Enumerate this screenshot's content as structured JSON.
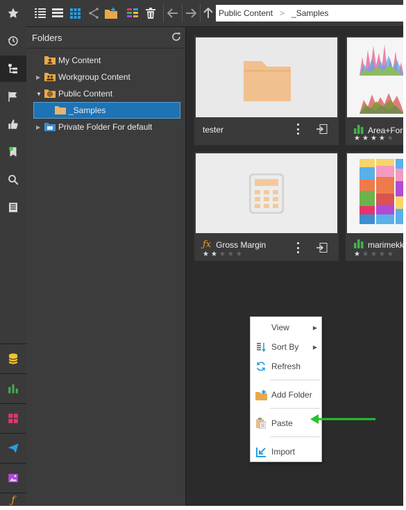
{
  "toolbar": {
    "breadcrumb": [
      "Public Content",
      "_Samples"
    ]
  },
  "folders_panel": {
    "title": "Folders",
    "items": [
      {
        "label": "My Content"
      },
      {
        "label": "Workgroup Content"
      },
      {
        "label": "Public Content"
      },
      {
        "label": "_Samples"
      },
      {
        "label": "Private Folder For default"
      }
    ]
  },
  "tiles": [
    {
      "title": "tester",
      "icon": "folder-icon",
      "stars_filled": 0
    },
    {
      "title": "Area+For",
      "icon": "chart-icon",
      "stars_filled": 4,
      "star_color": "#e0e0e0"
    },
    {
      "title": "Gross Margin",
      "icon": "formula-icon",
      "stars_filled": 2,
      "star_color": "#e0e0e0"
    },
    {
      "title": "marimekk",
      "icon": "chart-icon",
      "stars_filled": 1,
      "star_color": "#e0e0e0"
    }
  ],
  "context_menu": {
    "items": [
      {
        "label": "View",
        "has_submenu": true
      },
      {
        "label": "Sort By",
        "has_submenu": true
      },
      {
        "label": "Refresh",
        "has_submenu": false
      },
      {
        "label": "Add Folder",
        "has_submenu": false
      },
      {
        "label": "Paste",
        "has_submenu": false
      },
      {
        "label": "Import",
        "has_submenu": false
      }
    ]
  },
  "colors": {
    "accent": "#1e73b5",
    "folder": "#e8b46c",
    "annotation": "#21c62b",
    "chart_green": "#3fb34a"
  }
}
